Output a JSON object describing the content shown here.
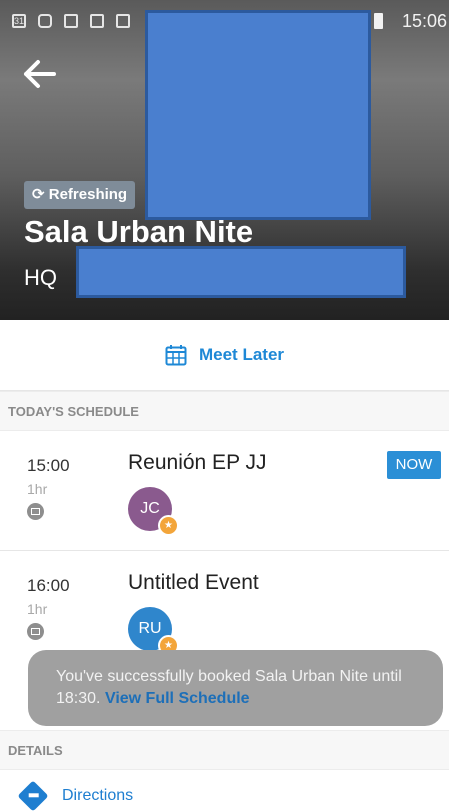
{
  "status_bar": {
    "time": "15:06",
    "icons": [
      "calendar-app-icon",
      "youtube-icon",
      "gallery-icon",
      "gmail-icon",
      "notification-icon"
    ],
    "calendar_icon_text": "31"
  },
  "header": {
    "refresh_chip": "Refreshing",
    "room_name": "Sala Urban Nite",
    "location": "HQ"
  },
  "meet_later": {
    "label": "Meet Later"
  },
  "schedule": {
    "header": "TODAY'S SCHEDULE",
    "events": [
      {
        "time": "15:00",
        "duration": "1hr",
        "title": "Reunión EP JJ",
        "initials": "JC",
        "avatar_color": "#8a5a8e",
        "badge": "NOW"
      },
      {
        "time": "16:00",
        "duration": "1hr",
        "title": "Untitled Event",
        "initials": "RU",
        "avatar_color": "#2f86cc"
      }
    ]
  },
  "toast": {
    "message": "You've successfully booked Sala Urban Nite until 18:30.",
    "link": "View Full Schedule"
  },
  "details": {
    "header": "DETAILS",
    "directions": "Directions"
  },
  "colors": {
    "accent": "#1e88d6",
    "now_badge": "#2b8fd6",
    "star": "#f3a53a",
    "redaction": "#4a7fcf"
  }
}
